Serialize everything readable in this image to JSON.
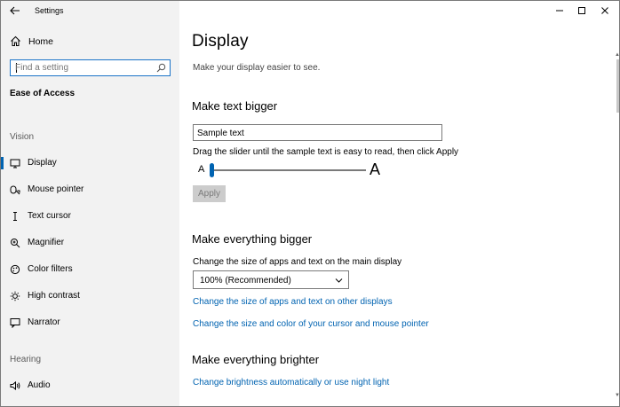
{
  "window": {
    "title": "Settings",
    "controls": {
      "minimize": "—",
      "maximize": "☐",
      "close": "✕"
    }
  },
  "sidebar": {
    "home_label": "Home",
    "search_placeholder": "Find a setting",
    "section_title": "Ease of Access",
    "groups": [
      {
        "label": "Vision",
        "items": [
          {
            "label": "Display",
            "icon": "display-icon",
            "selected": true
          },
          {
            "label": "Mouse pointer",
            "icon": "mouse-pointer-icon"
          },
          {
            "label": "Text cursor",
            "icon": "text-cursor-icon"
          },
          {
            "label": "Magnifier",
            "icon": "magnifier-icon"
          },
          {
            "label": "Color filters",
            "icon": "color-filters-icon"
          },
          {
            "label": "High contrast",
            "icon": "high-contrast-icon"
          },
          {
            "label": "Narrator",
            "icon": "narrator-icon"
          }
        ]
      },
      {
        "label": "Hearing",
        "items": [
          {
            "label": "Audio",
            "icon": "audio-icon"
          }
        ]
      }
    ]
  },
  "main": {
    "title": "Display",
    "subtitle": "Make your display easier to see.",
    "text_bigger": {
      "heading": "Make text bigger",
      "sample_text": "Sample text",
      "hint": "Drag the slider until the sample text is easy to read, then click Apply",
      "small_a": "A",
      "large_a": "A",
      "slider_value_percent": 0,
      "apply_label": "Apply"
    },
    "everything_bigger": {
      "heading": "Make everything bigger",
      "label": "Change the size of apps and text on the main display",
      "selected_value": "100% (Recommended)",
      "link_other_displays": "Change the size of apps and text on other displays",
      "link_cursor": "Change the size and color of your cursor and mouse pointer"
    },
    "everything_brighter": {
      "heading": "Make everything brighter",
      "link_brightness": "Change brightness automatically or use night light"
    }
  },
  "colors": {
    "accent": "#0063b1",
    "link": "#0063b1",
    "sidebar_bg": "#f2f2f2"
  }
}
